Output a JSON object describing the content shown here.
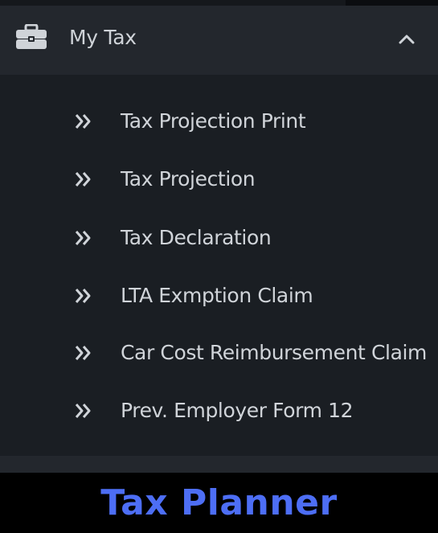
{
  "section": {
    "title": "My Tax",
    "icon": "briefcase-icon",
    "toggle_icon": "chevron-up-icon"
  },
  "menu": {
    "items": [
      {
        "label": "Tax Projection Print"
      },
      {
        "label": "Tax Projection"
      },
      {
        "label": "Tax Declaration"
      },
      {
        "label": "LTA Exmption Claim"
      },
      {
        "label": "Car Cost Reimbursement Claim"
      },
      {
        "label": "Prev. Employer Form 12"
      }
    ],
    "item_icon": "double-chevron-right-icon"
  },
  "caption": "Tax Planner",
  "colors": {
    "panel_bg": "#1a1e23",
    "header_bg": "#23272d",
    "text": "#d0d4d9",
    "caption": "#4d6ef5"
  }
}
